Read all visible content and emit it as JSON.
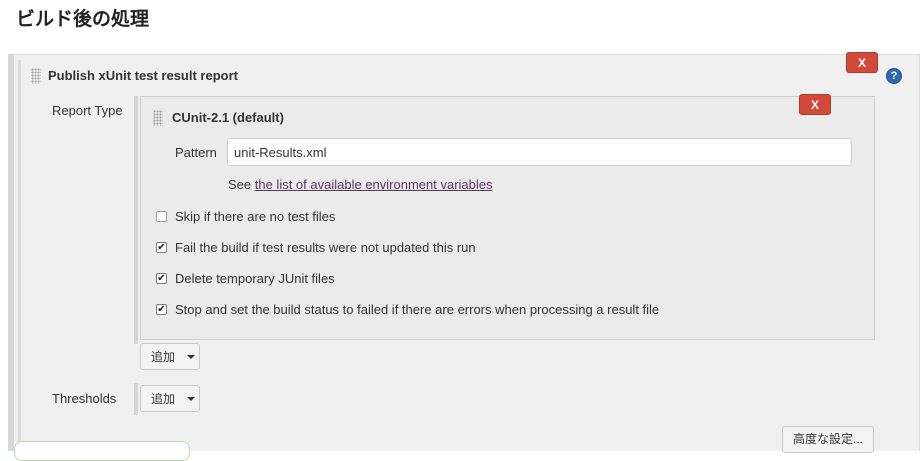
{
  "section": {
    "title": "ビルド後の処理"
  },
  "publisher": {
    "title": "Publish xUnit test result report",
    "delete_label": "X",
    "help_label": "?"
  },
  "report_type": {
    "label": "Report Type",
    "entry": {
      "title": "CUnit-2.1 (default)",
      "delete_label": "X",
      "pattern_label": "Pattern",
      "pattern_value": "unit-Results.xml",
      "env_prefix": "See ",
      "env_link": "the list of available environment variables",
      "options": [
        {
          "label": "Skip if there are no test files",
          "checked": false
        },
        {
          "label": "Fail the build if test results were not updated this run",
          "checked": true
        },
        {
          "label": "Delete temporary JUnit files",
          "checked": true
        },
        {
          "label": "Stop and set the build status to failed if there are errors when processing a result file",
          "checked": true
        }
      ]
    },
    "add_label": "追加"
  },
  "thresholds": {
    "label": "Thresholds",
    "add_label": "追加"
  },
  "advanced_label": "高度な設定..."
}
